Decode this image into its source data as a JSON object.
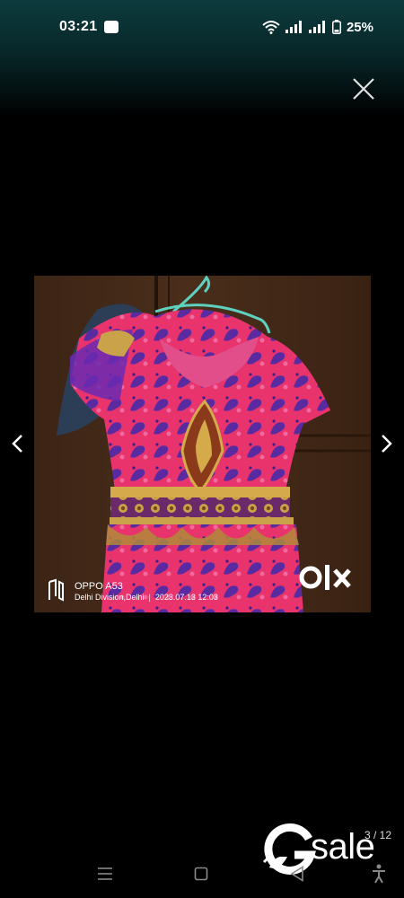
{
  "status_bar": {
    "time": "03:21",
    "battery": "25%",
    "icons": [
      "notification-icon",
      "wifi-icon",
      "signal-icon",
      "signal-icon",
      "battery-icon"
    ]
  },
  "viewer": {
    "close_icon": "close-icon",
    "prev_icon": "chevron-left-icon",
    "next_icon": "chevron-right-icon",
    "counter": "3 / 12"
  },
  "photo": {
    "watermark_brand": "OLX",
    "device": "OPPO A53",
    "location": "Delhi Division,Delhi",
    "timestamp": "2023.07.13 12:03"
  },
  "overlay_logo": "sale",
  "colors": {
    "background": "#000000",
    "top_gradient": "#0d3b3d",
    "dress_pink": "#e8336d",
    "dress_purple": "#5a2aa0"
  },
  "nav_bar": {
    "icons": [
      "menu-icon",
      "home-square-icon",
      "back-triangle-icon",
      "accessibility-icon"
    ]
  }
}
